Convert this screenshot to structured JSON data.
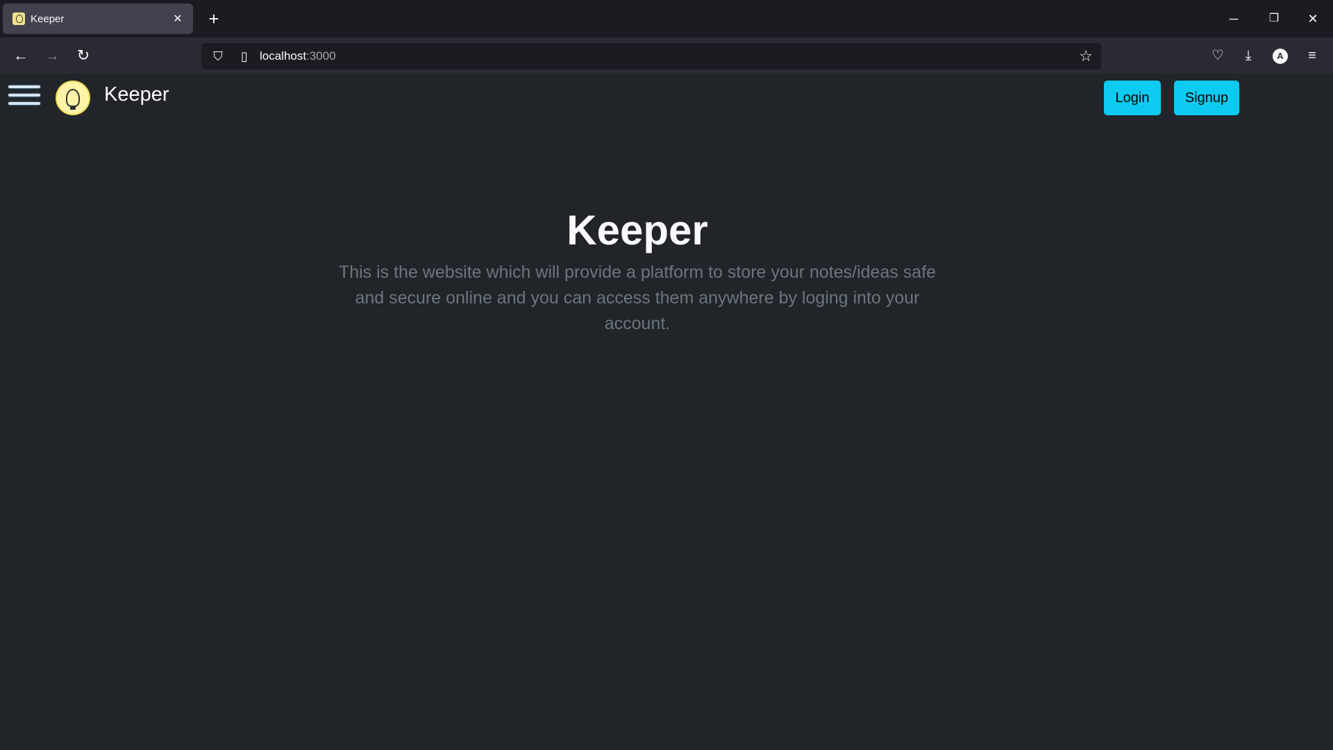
{
  "browser": {
    "tab_title": "Keeper",
    "url_host": "localhost",
    "url_port": ":3000",
    "new_tab_label": "+",
    "controls": {
      "minimize": "─",
      "restore": "❐",
      "close": "✕"
    },
    "avatar_initial": "A"
  },
  "navbar": {
    "brand": "Keeper",
    "login_label": "Login",
    "signup_label": "Signup"
  },
  "hero": {
    "title": "Keeper",
    "description": "This is the website which will provide a platform to store your notes/ideas safe and secure online and you can access them anywhere by loging into your account."
  },
  "colors": {
    "page_background": "#212529",
    "accent": "#0dcaf0",
    "muted_text": "#6c757d"
  }
}
